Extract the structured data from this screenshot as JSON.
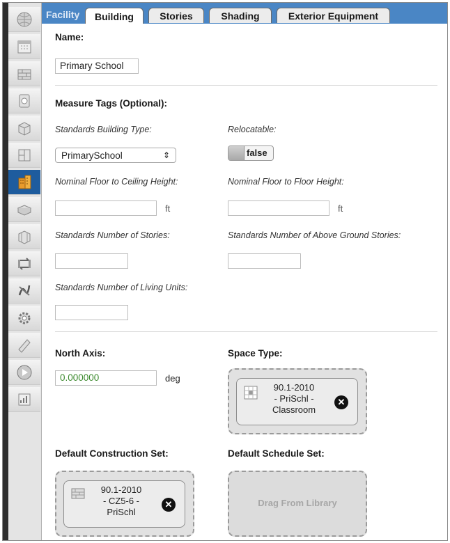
{
  "tabs": {
    "facility": "Facility",
    "items": [
      "Building",
      "Stories",
      "Shading",
      "Exterior Equipment"
    ]
  },
  "sidebar": {
    "icons": [
      "site-icon",
      "schedules-icon",
      "constructions-icon",
      "loads-icon",
      "space-types-icon",
      "geometry-icon",
      "facility-icon",
      "spaces-icon",
      "thermal-zones-icon",
      "hvac-systems-icon",
      "output-variables-icon",
      "simulation-settings-icon",
      "measures-icon",
      "run-icon",
      "results-icon"
    ],
    "active_index": 6
  },
  "form": {
    "name_label": "Name:",
    "name_value": "Primary School",
    "measure_tags_label": "Measure Tags (Optional):",
    "standards_building_type_label": "Standards Building Type:",
    "standards_building_type_value": "PrimarySchool",
    "relocatable_label": "Relocatable:",
    "relocatable_value": "false",
    "nominal_floor_ceiling_label": "Nominal Floor to Ceiling Height:",
    "nominal_floor_ceiling_unit": "ft",
    "nominal_floor_floor_label": "Nominal Floor to Floor Height:",
    "nominal_floor_floor_unit": "ft",
    "num_stories_label": "Standards Number of Stories:",
    "num_above_ground_label": "Standards Number of Above Ground Stories:",
    "num_living_units_label": "Standards Number of Living Units:",
    "north_axis_label": "North Axis:",
    "north_axis_value": "0.000000",
    "north_axis_unit": "deg",
    "space_type_label": "Space Type:",
    "space_type_lines": [
      "90.1-2010",
      "- PriSchl -",
      "Classroom"
    ],
    "construction_set_label": "Default Construction Set:",
    "construction_set_lines": [
      "90.1-2010",
      "- CZ5-6 -",
      "PriSchl"
    ],
    "schedule_set_label": "Default Schedule Set:",
    "schedule_set_hint": "Drag From Library",
    "remove_symbol": "✕",
    "select_arrows": "⇕"
  },
  "colors": {
    "tab_bar": "#4a86c5",
    "active_nav": "#1e5c9e",
    "north_axis_text": "#3c8a2e"
  }
}
